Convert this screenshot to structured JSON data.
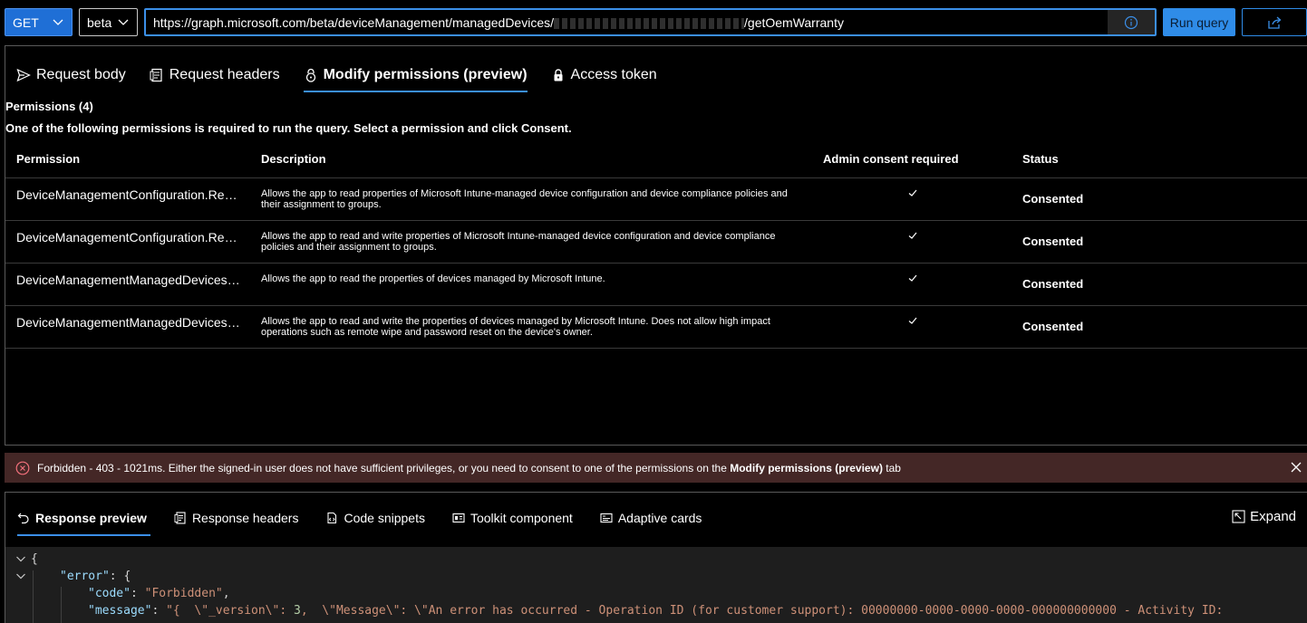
{
  "query": {
    "method": "GET",
    "version": "beta",
    "url": "https://graph.microsoft.com/beta/deviceManagement/managedDevices/",
    "url_suffix": "/getOemWarranty",
    "run_label": "Run query"
  },
  "request_tabs": [
    {
      "label": "Request body",
      "icon": "send-icon"
    },
    {
      "label": "Request headers",
      "icon": "headers-icon"
    },
    {
      "label": "Modify permissions (preview)",
      "icon": "lock-icon",
      "active": true
    },
    {
      "label": "Access token",
      "icon": "access-token-icon"
    }
  ],
  "permissions": {
    "count_label": "Permissions (4)",
    "note": "One of the following permissions is required to run the query. Select a permission and click Consent.",
    "headers": {
      "permission": "Permission",
      "description": "Description",
      "admin": "Admin consent required",
      "status": "Status"
    },
    "rows": [
      {
        "name": "DeviceManagementConfiguration.Read.All",
        "description": "Allows the app to read properties of Microsoft Intune-managed device configuration and device compliance policies and their assignment to groups.",
        "admin_required": true,
        "status": "Consented"
      },
      {
        "name": "DeviceManagementConfiguration.ReadWrite.All",
        "description": "Allows the app to read and write properties of Microsoft Intune-managed device configuration and device compliance policies and their assignment to groups.",
        "admin_required": true,
        "status": "Consented"
      },
      {
        "name": "DeviceManagementManagedDevices.Read.All",
        "description": "Allows the app to read the properties of devices managed by Microsoft Intune.",
        "admin_required": true,
        "status": "Consented"
      },
      {
        "name": "DeviceManagementManagedDevices.ReadWrite.All",
        "description": "Allows the app to read and write the properties of devices managed by Microsoft Intune. Does not allow high impact operations such as remote wipe and password reset on the device's owner.",
        "admin_required": true,
        "status": "Consented"
      }
    ]
  },
  "error": {
    "text_before": "Forbidden - 403 - 1021ms. Either the signed-in user does not have sufficient privileges, or you need to consent to one of the permissions on the ",
    "text_bold": "Modify permissions (preview)",
    "text_after": " tab"
  },
  "response_tabs": [
    {
      "label": "Response preview",
      "icon": "undo-icon",
      "active": true
    },
    {
      "label": "Response headers",
      "icon": "headers-icon"
    },
    {
      "label": "Code snippets",
      "icon": "code-snippets-icon"
    },
    {
      "label": "Toolkit component",
      "icon": "toolkit-icon"
    },
    {
      "label": "Adaptive cards",
      "icon": "adaptive-cards-icon"
    }
  ],
  "expand_label": "Expand",
  "response_code": {
    "line1": "{",
    "line2_key": "\"error\"",
    "line2_rest": ": {",
    "line3_key": "\"code\"",
    "line3_val": "\"Forbidden\"",
    "line4_key": "\"message\"",
    "line4_val_a": "\"{  \\\"_version\\\": ",
    "line4_num": "3",
    "line4_val_b": ",  \\\"Message\\\": \\\"An error has occurred - Operation ID (for customer support): 00000000-0000-0000-0000-000000000000 - Activity ID:"
  },
  "colors": {
    "accent": "#3b8fe8",
    "error_bg": "#442726",
    "code_bg": "#1e1e1e"
  }
}
